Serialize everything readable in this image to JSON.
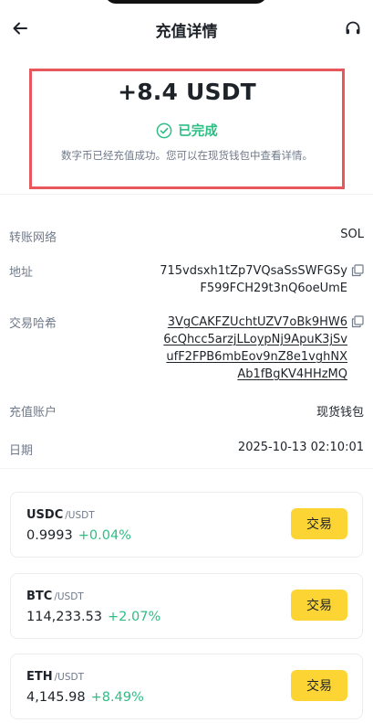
{
  "header": {
    "title": "充值详情",
    "back_icon": "back-arrow-icon",
    "support_icon": "headset-icon"
  },
  "summary": {
    "amount": "+8.4 USDT",
    "status": "已完成",
    "status_icon": "check-circle-icon",
    "message": "数字币已经充值成功。您可以在现货钱包中查看详情。"
  },
  "details": {
    "network_label": "转账网络",
    "network_value": "SOL",
    "address_label": "地址",
    "address_lines": [
      "715vdsxh1tZp7VQsaSsSWFGSy",
      "F599FCH29t3nQ6oeUmE"
    ],
    "hash_label": "交易哈希",
    "hash_lines": [
      "3VgCAKFZUchtUZV7oBk9HW6",
      "6cQhcc5arzjLLoypNj9ApuK3jSv",
      "ufF2FPB6mbEov9nZ8e1vghNX",
      "Ab1fBgKV4HHzMQ"
    ],
    "account_label": "充值账户",
    "account_value": "现货钱包",
    "date_label": "日期",
    "date_value": "2025-10-13 02:10:01"
  },
  "markets": [
    {
      "symbol": "USDC",
      "quote": "/USDT",
      "price": "0.9993",
      "change": "+0.04%",
      "button": "交易"
    },
    {
      "symbol": "BTC",
      "quote": "/USDT",
      "price": "114,233.53",
      "change": "+2.07%",
      "button": "交易"
    },
    {
      "symbol": "ETH",
      "quote": "/USDT",
      "price": "4,145.98",
      "change": "+8.49%",
      "button": "交易"
    }
  ],
  "colors": {
    "accent_yellow": "#fcd535",
    "positive_green": "#2ebd85",
    "highlight_border": "#e8575b",
    "text_primary": "#1e2329",
    "text_secondary": "#707a8a"
  }
}
